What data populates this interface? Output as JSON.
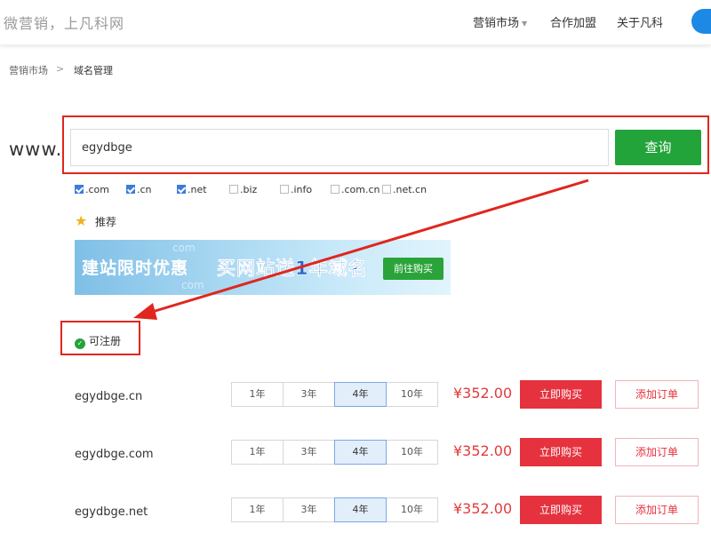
{
  "header": {
    "logo": "微营销，上凡科网",
    "nav": [
      {
        "label": "营销市场",
        "has_dropdown": true
      },
      {
        "label": "合作加盟"
      },
      {
        "label": "关于凡科"
      }
    ]
  },
  "breadcrumb": {
    "items": [
      "营销市场",
      "域名管理"
    ],
    "separator": ">"
  },
  "search": {
    "prefix": "www.",
    "value": "egydbge",
    "button_label": "查询"
  },
  "tlds": [
    {
      "label": ".com",
      "checked": true
    },
    {
      "label": ".cn",
      "checked": true
    },
    {
      "label": ".net",
      "checked": true
    },
    {
      "label": ".biz",
      "checked": false
    },
    {
      "label": ".info",
      "checked": false
    },
    {
      "label": ".com.cn",
      "checked": false
    },
    {
      "label": ".net.cn",
      "checked": false
    }
  ],
  "recommend": {
    "label": "推荐",
    "icon": "star-icon"
  },
  "banner": {
    "left_text": "建站限时优惠",
    "mid_text": "买网站送1年域名",
    "button_label": "前往购买",
    "ghost_text": "com"
  },
  "available": {
    "label": "可注册",
    "icon": "check-circle-icon"
  },
  "results": [
    {
      "domain": "egydbge.cn",
      "years": [
        "1年",
        "3年",
        "4年",
        "10年"
      ],
      "selected_year": "4年",
      "price": "¥352.00",
      "buy_label": "立即购买",
      "cart_label": "添加订单"
    },
    {
      "domain": "egydbge.com",
      "years": [
        "1年",
        "3年",
        "4年",
        "10年"
      ],
      "selected_year": "4年",
      "price": "¥352.00",
      "buy_label": "立即购买",
      "cart_label": "添加订单"
    },
    {
      "domain": "egydbge.net",
      "years": [
        "1年",
        "3年",
        "4年",
        "10年"
      ],
      "selected_year": "4年",
      "price": "¥352.00",
      "buy_label": "立即购买",
      "cart_label": "添加订单"
    }
  ],
  "colors": {
    "accent_green": "#22a43a",
    "buy_red": "#e5323e",
    "annotation_red": "#e0261e",
    "checkbox_blue": "#3d7bdc"
  }
}
